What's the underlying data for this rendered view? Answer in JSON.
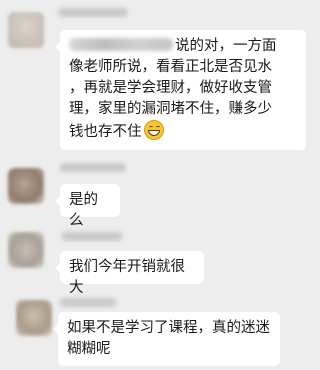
{
  "messages": [
    {
      "lines": [
        "说的对，一方面",
        "像老师所说，看看正北是否见水",
        "，再就是学会理财，做好收支管",
        "理，家里的漏洞堵不住，赚多少",
        "钱也存不住"
      ],
      "emoji": "grinning-emoji"
    },
    {
      "text": "是的么"
    },
    {
      "text": "我们今年开销就很大"
    },
    {
      "lines": [
        "如果不是学习了课程，真的迷迷",
        "糊糊呢"
      ]
    }
  ]
}
